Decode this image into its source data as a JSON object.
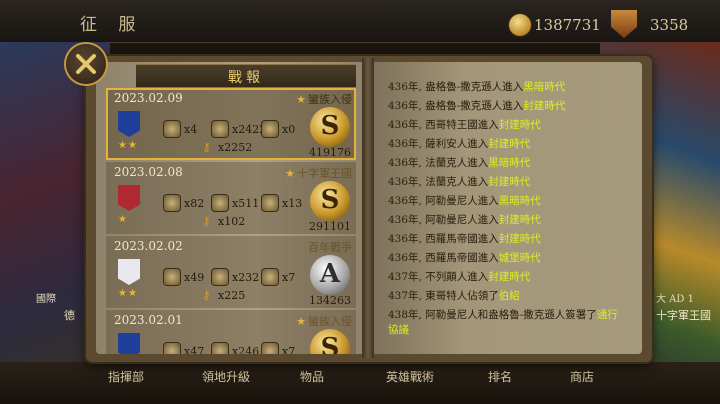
{
  "topbar": {
    "title": "征 服",
    "coins": "1387731",
    "gems": "3358"
  },
  "background": {
    "left_label": "國際",
    "left_frag": "德",
    "right_tag": "大 AD 1",
    "right_name": "十字軍王國"
  },
  "bottom_buttons": [
    "指揮部",
    "領地升級",
    "物品",
    "英雄戰術",
    "排名",
    "商店"
  ],
  "panel": {
    "title": "戰報"
  },
  "reports": [
    {
      "date": "2023.02.09",
      "tag": "蠻族入侵",
      "tag_star": true,
      "rank_stars": "★★",
      "units": "x4",
      "count2": "x2422",
      "count3": "x0",
      "keys": "x2252",
      "badge": "S",
      "score": "419176",
      "banner_color": "#1f3f9a",
      "selected": true
    },
    {
      "date": "2023.02.08",
      "tag": "十字軍王國",
      "tag_star": true,
      "rank_stars": "★",
      "units": "x82",
      "count2": "x511",
      "count3": "x13",
      "keys": "x102",
      "badge": "S",
      "score": "291101",
      "banner_color": "#b02830",
      "selected": false
    },
    {
      "date": "2023.02.02",
      "tag": "百年戰爭",
      "tag_star": false,
      "rank_stars": "★★",
      "units": "x49",
      "count2": "x232",
      "count3": "x7",
      "keys": "x225",
      "badge": "A",
      "score": "134263",
      "banner_color": "#e8e8ee",
      "selected": false
    },
    {
      "date": "2023.02.01",
      "tag": "蠻族入侵",
      "tag_star": true,
      "rank_stars": "",
      "units": "x47",
      "count2": "x246",
      "count3": "x7",
      "keys": "",
      "badge": "S",
      "score": "",
      "banner_color": "#1f3f9a",
      "selected": false
    }
  ],
  "log": [
    {
      "text": "436年, 盎格魯-撒克遜人進入",
      "era": "黑暗時代"
    },
    {
      "text": "436年, 盎格魯-撒克遜人進入",
      "era": "封建時代"
    },
    {
      "text": "436年, 西哥特王國進入",
      "era": "封建時代"
    },
    {
      "text": "436年, 薩利安人進入",
      "era": "封建時代"
    },
    {
      "text": "436年, 法蘭克人進入",
      "era": "黑暗時代"
    },
    {
      "text": "436年, 法蘭克人進入",
      "era": "封建時代"
    },
    {
      "text": "436年, 阿勒曼尼人進入",
      "era": "黑暗時代"
    },
    {
      "text": "436年, 阿勒曼尼人進入",
      "era": "封建時代"
    },
    {
      "text": "436年, 西羅馬帝國進入",
      "era": "封建時代"
    },
    {
      "text": "436年, 西羅馬帝國進入",
      "era": "城堡時代"
    },
    {
      "text": "437年, 不列顛人進入",
      "era": "封建時代"
    },
    {
      "text": "437年, 東哥特人佔領了",
      "era": "伯紹"
    },
    {
      "text": "438年, 阿勒曼尼人和盎格魯-撒克遜人簽署了",
      "era": "通行協議"
    }
  ]
}
